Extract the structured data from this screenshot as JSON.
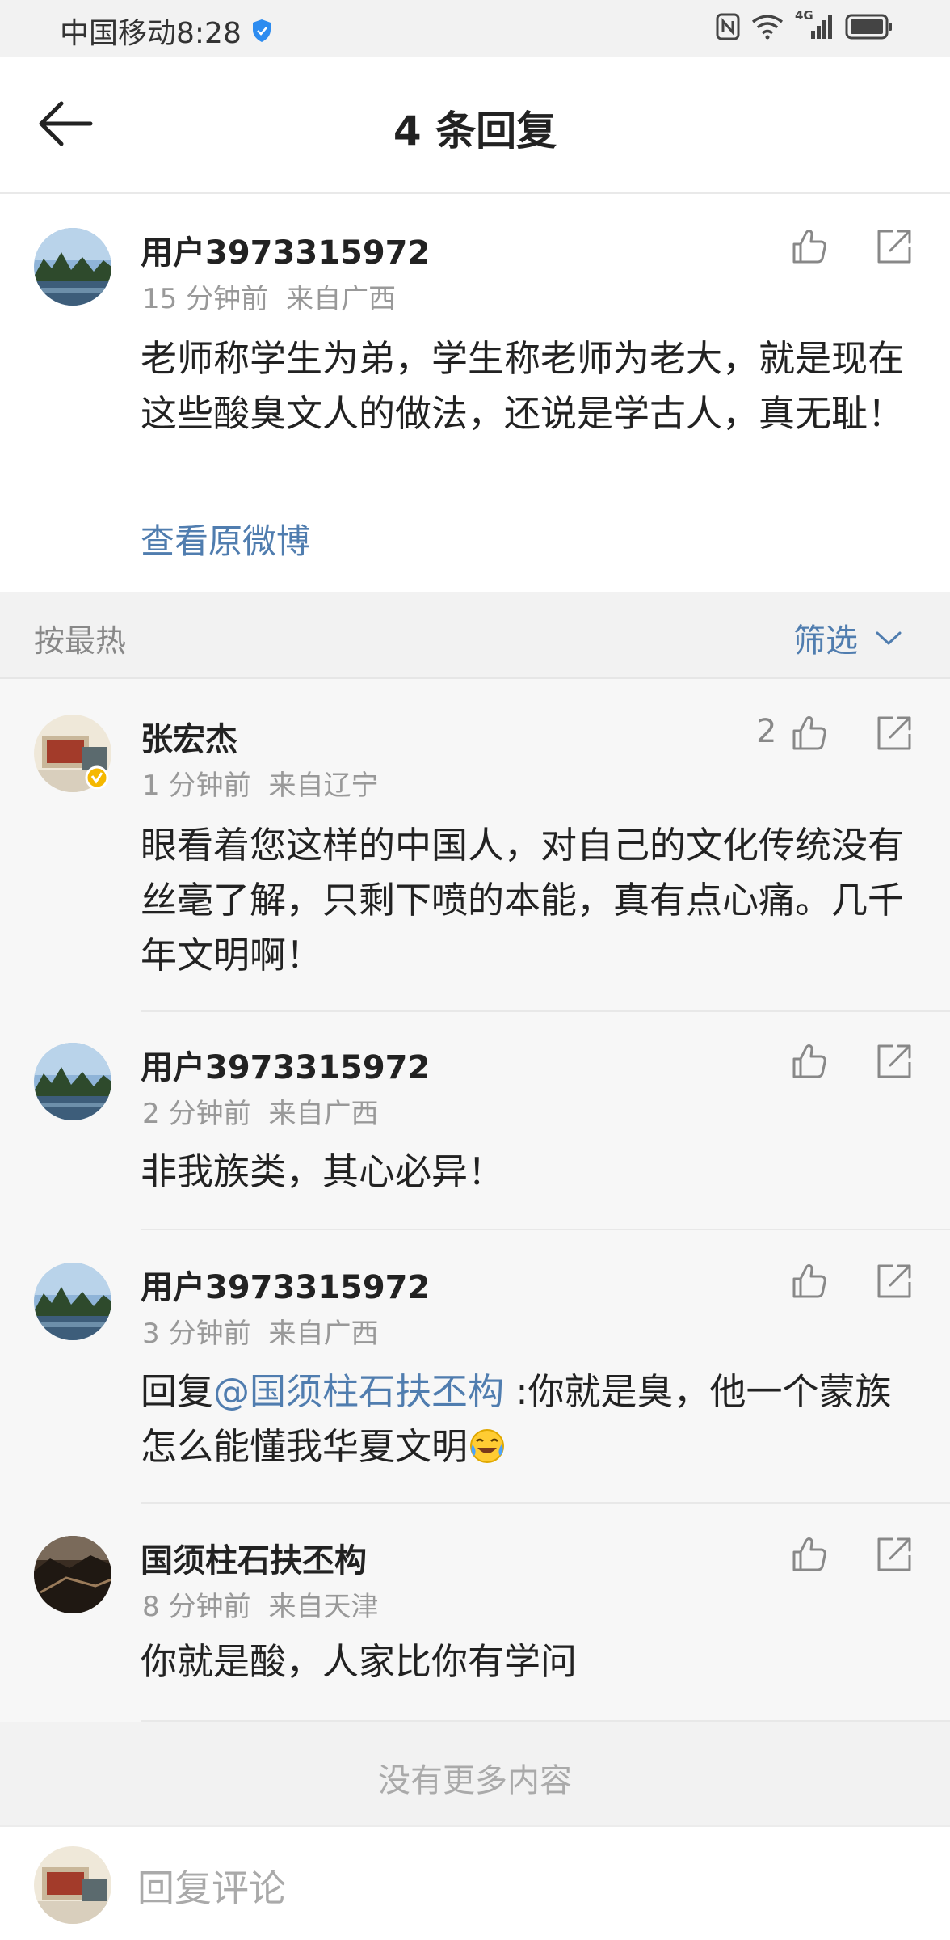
{
  "status": {
    "carrier_time": "中国移动8:28",
    "network": "4G"
  },
  "header": {
    "title": "4 条回复",
    "back_icon": "arrow-left-icon"
  },
  "original": {
    "username": "用户3973315972",
    "time": "15 分钟前",
    "location": "来自广西",
    "content": "老师称学生为弟，学生称老师为老大，就是现在这些酸臭文人的做法，还说是学古人，真无耻！",
    "view_original": "查看原微博"
  },
  "sort_bar": {
    "sort_label": "按最热",
    "filter_label": "筛选"
  },
  "replies": [
    {
      "username": "张宏杰",
      "time": "1 分钟前",
      "location": "来自辽宁",
      "likes": "2",
      "content": "眼看着您这样的中国人，对自己的文化传统没有丝毫了解，只剩下喷的本能，真有点心痛。几千年文明啊！"
    },
    {
      "username": "用户3973315972",
      "time": "2 分钟前",
      "location": "来自广西",
      "content": "非我族类，其心必异！"
    },
    {
      "username": "用户3973315972",
      "time": "3 分钟前",
      "location": "来自广西",
      "prefix": "回复",
      "mention": "@国须柱石扶丕构",
      "content": " :你就是臭，他一个蒙族怎么能懂我华夏文明"
    },
    {
      "username": "国须柱石扶丕构",
      "time": "8 分钟前",
      "location": "来自天津",
      "content": "你就是酸，人家比你有学问"
    }
  ],
  "footer": {
    "no_more": "没有更多内容",
    "reply_placeholder": "回复评论"
  },
  "colors": {
    "link": "#507daf",
    "meta": "#999999",
    "background": "#f2f2f2"
  }
}
